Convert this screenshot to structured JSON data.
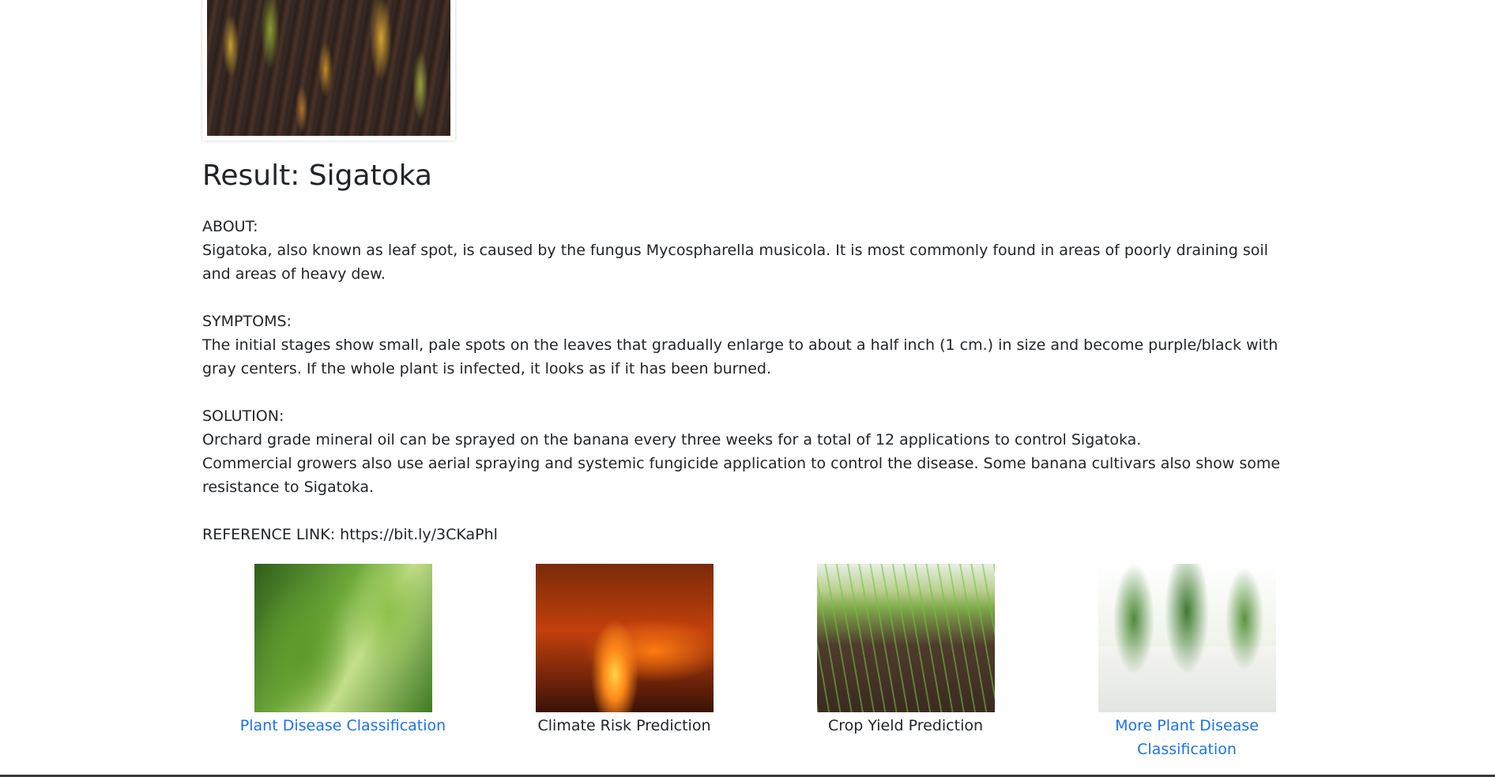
{
  "result": {
    "heading": "Result: Sigatoka"
  },
  "about": {
    "label": "ABOUT:",
    "text": "Sigatoka, also known as leaf spot, is caused by the fungus Mycospharella musicola. It is most commonly found in areas of poorly draining soil and areas of heavy dew."
  },
  "symptoms": {
    "label": "SYMPTOMS:",
    "text": "The initial stages show small, pale spots on the leaves that gradually enlarge to about a half inch (1 cm.) in size and become purple/black with gray centers. If the whole plant is infected, it looks as if it has been burned."
  },
  "solution": {
    "label": "SOLUTION:",
    "line1": "Orchard grade mineral oil can be sprayed on the banana every three weeks for a total of 12 applications to control Sigatoka.",
    "line2": "Commercial growers also use aerial spraying and systemic fungicide application to control the disease. Some banana cultivars also show some resistance to Sigatoka."
  },
  "reference": {
    "text": "REFERENCE LINK: https://bit.ly/3CKaPhl"
  },
  "cards": [
    {
      "label": "Plant Disease Classification",
      "is_link": true
    },
    {
      "label": "Climate Risk Prediction",
      "is_link": false
    },
    {
      "label": "Crop Yield Prediction",
      "is_link": false
    },
    {
      "label": "More Plant Disease Classification",
      "is_link": true
    }
  ],
  "colors": {
    "link": "#1a73e8",
    "text": "#212529"
  }
}
